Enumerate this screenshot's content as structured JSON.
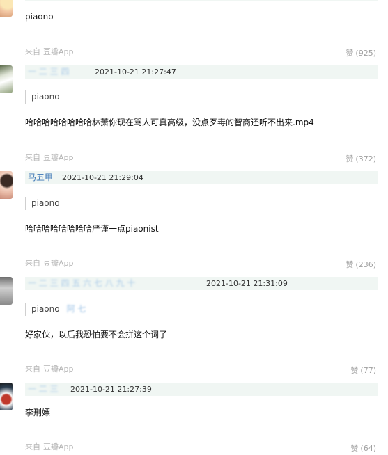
{
  "source_label": "来自",
  "source_app": "豆瓣App",
  "like_label": "赞",
  "comments": [
    {
      "author": "",
      "time": "",
      "quote": "",
      "quote_extra": "",
      "content": "piaono",
      "likes": "(925)"
    },
    {
      "author": "一 二 三 四",
      "time": "2021-10-21 21:27:47",
      "quote": "piaono",
      "quote_extra": "",
      "content": "哈哈哈哈哈哈哈哈林萧你现在骂人可真高级，没点歹毒的智商还听不出来.mp4",
      "likes": "(372)"
    },
    {
      "author": "马五甲",
      "time": "2021-10-21 21:29:04",
      "quote": "piaono",
      "quote_extra": "",
      "content": "哈哈哈哈哈哈哈哈严谨一点piaonist",
      "likes": "(236)"
    },
    {
      "author": "一 二 三 四 五 六 七 八 九 十",
      "time": "2021-10-21 21:31:09",
      "quote": "piaono",
      "quote_extra": "阿 七",
      "content": "好家伙，以后我恐怕要不会拼这个词了",
      "likes": "(77)"
    },
    {
      "author": "一 二 三",
      "time": "2021-10-21 21:27:39",
      "quote": "",
      "quote_extra": "",
      "content": "李刑嫖",
      "likes": "(64)"
    }
  ]
}
